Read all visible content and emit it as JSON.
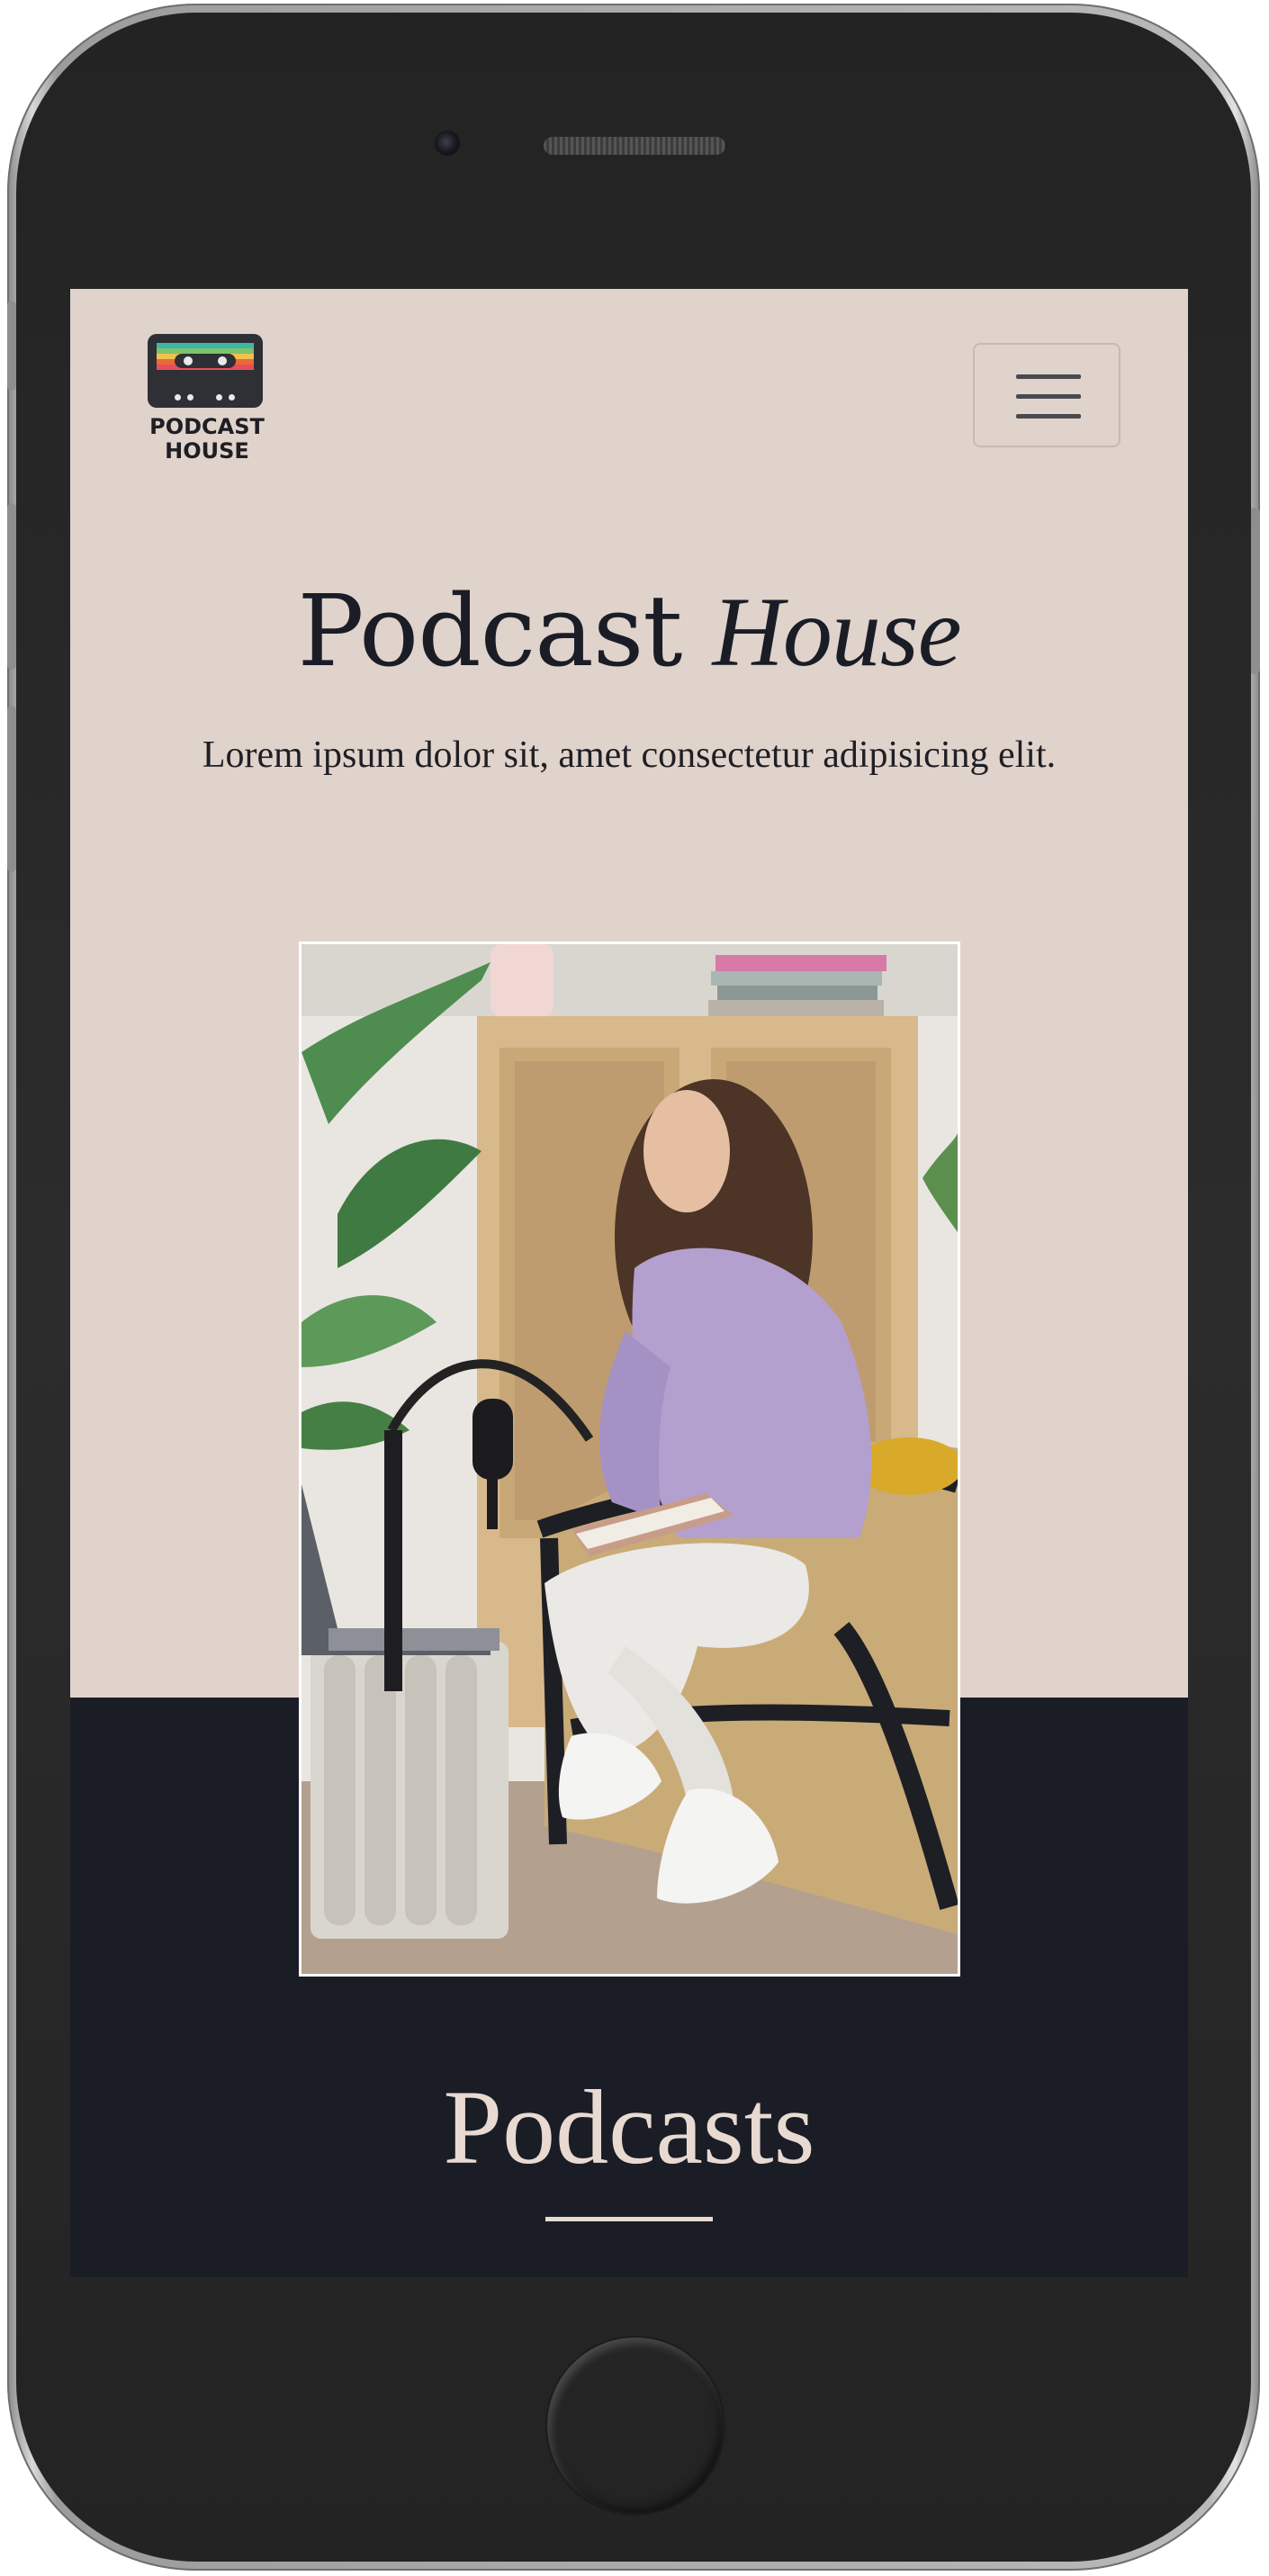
{
  "app": {
    "logo": {
      "line1": "PODCAST",
      "line2": "HOUSE"
    },
    "menu_icon": "hamburger-menu-icon"
  },
  "hero": {
    "title_main": "Podcast",
    "title_script": "House",
    "subtitle": "Lorem ipsum dolor sit, amet consectetur adipisicing elit."
  },
  "photo": {
    "subject": "woman in lavender sweater seated in rattan chair with notebook beside microphone and laptop"
  },
  "section": {
    "podcasts_title": "Podcasts"
  },
  "colors": {
    "hero_bg": "#e0d3cb",
    "dark_bg": "#1a1d26",
    "accent_text": "#e8dad1"
  }
}
